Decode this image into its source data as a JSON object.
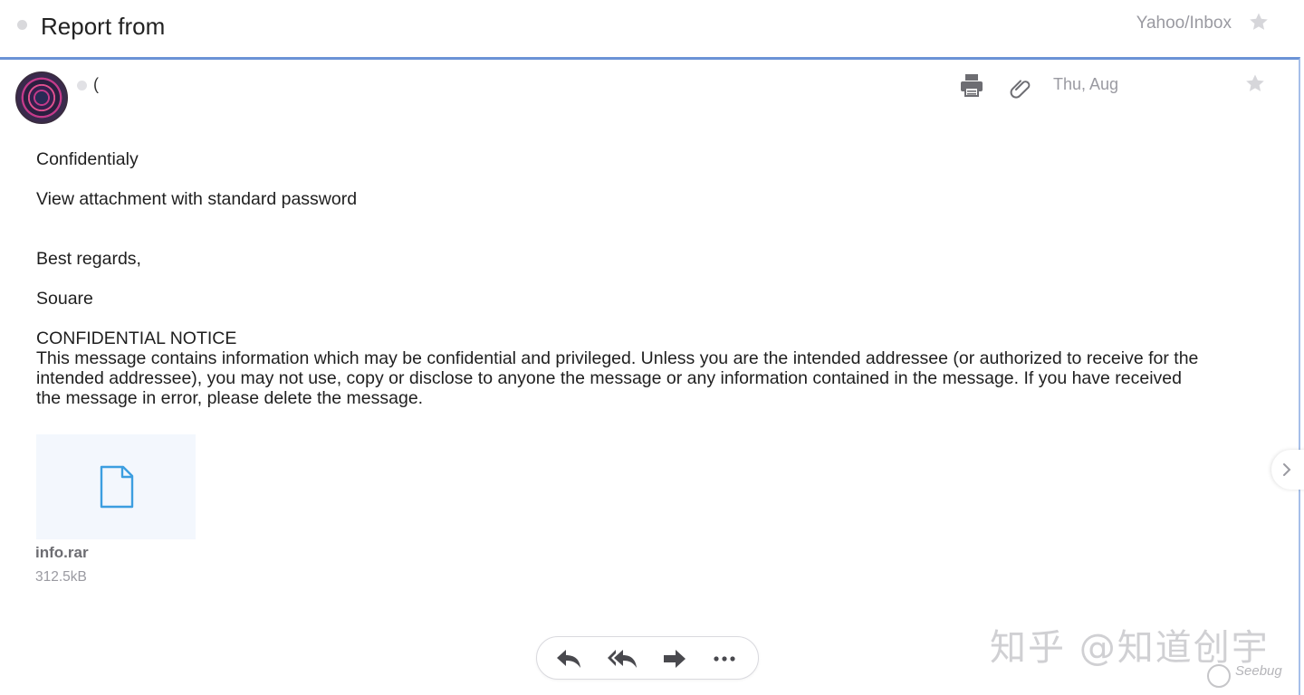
{
  "header": {
    "subject": "Report from",
    "folder": "Yahoo/Inbox"
  },
  "message": {
    "sender": "(",
    "date": "Thu, Aug",
    "body": {
      "line1": "Confidentialy",
      "line2": "View attachment with standard password",
      "line3": "Best regards,",
      "line4": "Souare",
      "notice_title": "CONFIDENTIAL NOTICE",
      "notice_text": "This message contains information which may be confidential and privileged. Unless you are the intended addressee (or authorized to receive for the intended addressee), you may not use, copy or disclose to anyone the message or any information contained in the message. If you have received the message in error, please delete the message."
    },
    "attachment": {
      "name": "info.rar",
      "size": "312.5kB",
      "icon": "file-icon"
    }
  },
  "toolbar": {
    "icons": [
      "reply-icon",
      "reply-all-icon",
      "forward-icon",
      "more-icon"
    ]
  },
  "watermark": {
    "zhihu": "知乎 @知道创宇",
    "seebug": "Seebug"
  },
  "colors": {
    "accent_border": "#6b93d6",
    "file_icon": "#3c9ee0",
    "muted_text": "#9a9aa1"
  }
}
